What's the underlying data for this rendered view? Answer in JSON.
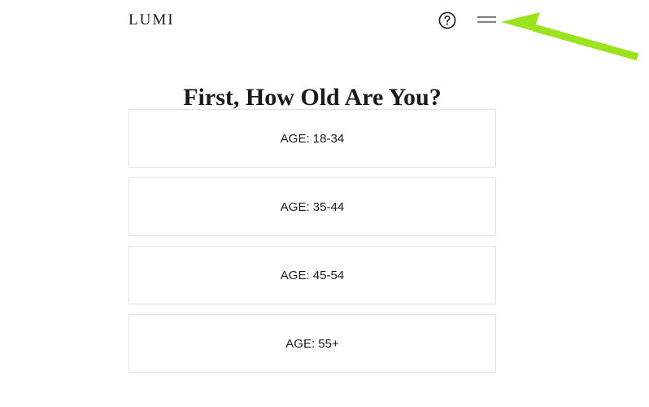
{
  "header": {
    "logo": "LUMI",
    "help_icon": "question-circle-icon",
    "menu_icon": "hamburger-menu-icon"
  },
  "annotation": {
    "icon": "arrow-icon",
    "color": "#9be31d"
  },
  "page": {
    "title": "First, How Old Are You?"
  },
  "options": [
    {
      "label": "AGE: 18-34"
    },
    {
      "label": "AGE: 35-44"
    },
    {
      "label": "AGE: 45-54"
    },
    {
      "label": "AGE: 55+"
    }
  ]
}
